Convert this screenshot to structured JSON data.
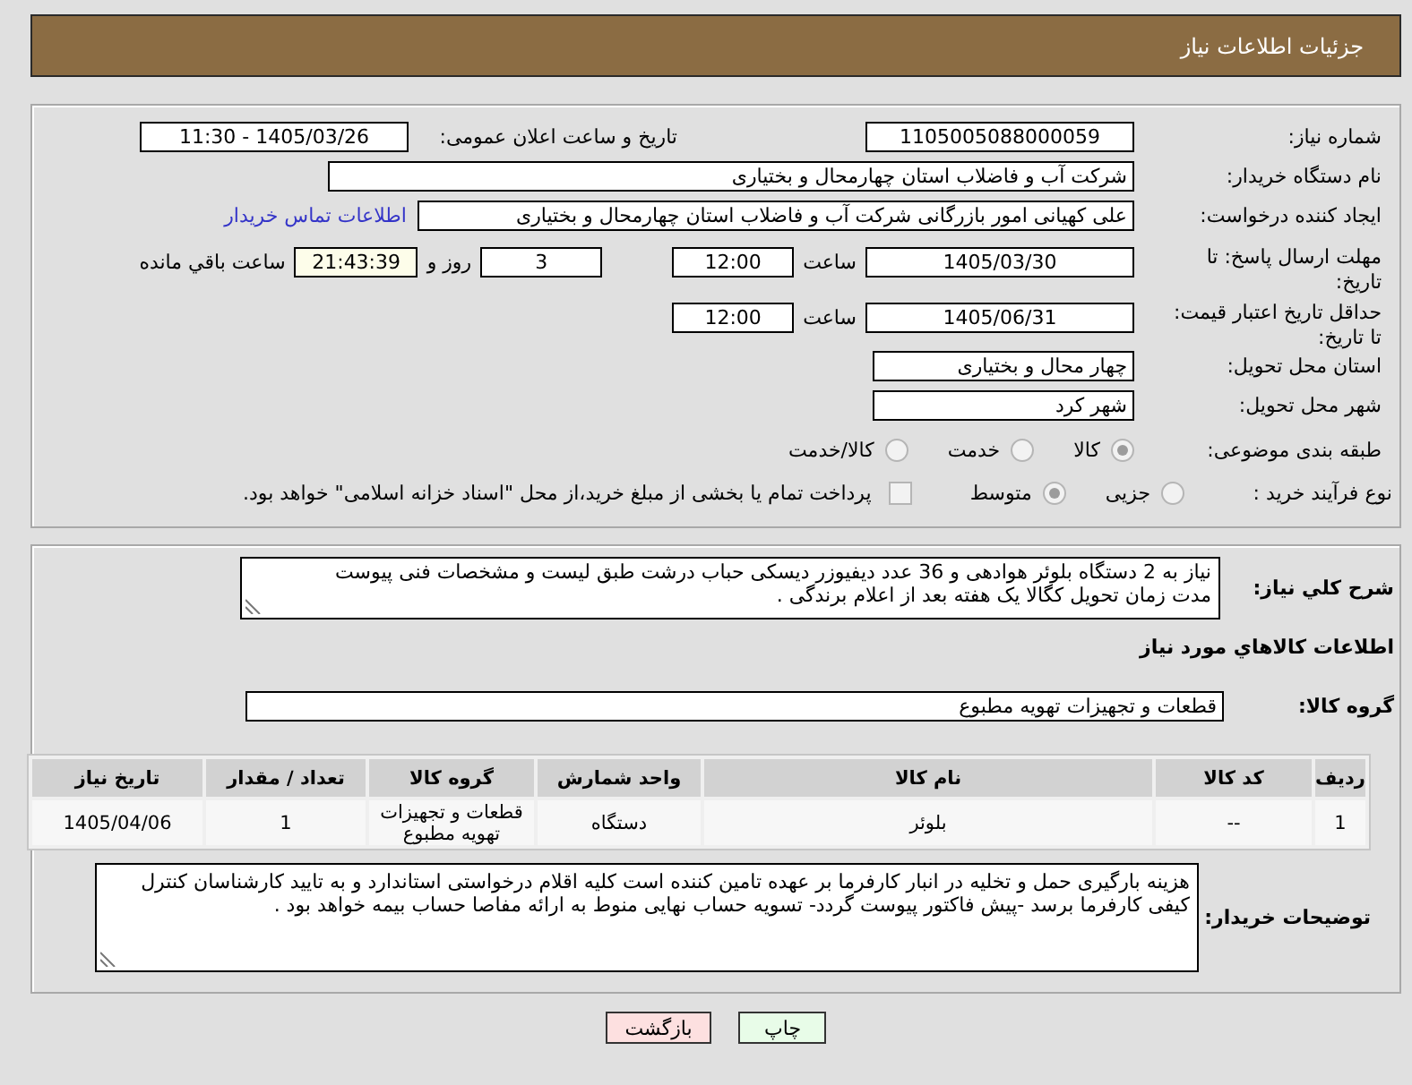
{
  "header": {
    "title": "جزئیات اطلاعات نیاز"
  },
  "details": {
    "need_number": {
      "label": "شماره نیاز:",
      "value": "1105005088000059"
    },
    "announce": {
      "label": "تاریخ و ساعت اعلان عمومی:",
      "value": "1405/03/26 - 11:30"
    },
    "buyer_org": {
      "label": "نام دستگاه خریدار:",
      "value": "شرکت آب و فاضلاب استان چهارمحال و بختیاری"
    },
    "requester": {
      "label": "ایجاد کننده درخواست:",
      "value": "علی کهیانی امور بازرگانی شرکت آب و فاضلاب استان چهارمحال و بختیاری",
      "link": "اطلاعات تماس خریدار"
    },
    "response_deadline": {
      "label": "مهلت ارسال پاسخ: تا تاریخ:",
      "date": "1405/03/30",
      "time_label": "ساعت",
      "time": "12:00",
      "days": "3",
      "days_label": "روز و",
      "remaining": "21:43:39",
      "remaining_label": "ساعت باقي مانده"
    },
    "price_validity": {
      "label": "حداقل تاریخ اعتبار قیمت: تا تاریخ:",
      "date": "1405/06/31",
      "time_label": "ساعت",
      "time": "12:00"
    },
    "delivery_province": {
      "label": "استان محل تحویل:",
      "value": "چهار محال و بختیاری"
    },
    "delivery_city": {
      "label": "شهر محل تحویل:",
      "value": "شهر کرد"
    },
    "subject_category": {
      "label": "طبقه بندی موضوعی:",
      "options": [
        {
          "label": "کالا",
          "selected": true
        },
        {
          "label": "خدمت",
          "selected": false
        },
        {
          "label": "کالا/خدمت",
          "selected": false
        }
      ]
    },
    "purchase_type": {
      "label": "نوع فرآیند خرید :",
      "options": [
        {
          "label": "جزیی",
          "selected": false
        },
        {
          "label": "متوسط",
          "selected": true
        }
      ],
      "treasury_payment": {
        "label": "پرداخت تمام یا بخشی از مبلغ خرید،از محل \"اسناد خزانه اسلامی\" خواهد بود.",
        "checked": false
      }
    }
  },
  "description": {
    "label": "شرح كلي نياز:",
    "value": "نیاز به 2 دستگاه بلوئر هوادهی و 36 عدد دیفیوزر دیسکی حباب درشت طبق لیست و مشخصات فنی پیوست\nمدت زمان تحویل کگالا یک هفته بعد از اعلام برندگی ."
  },
  "goods": {
    "title": "اطلاعات كالاهاي مورد نياز",
    "group_label": "گروه كالا:",
    "group_value": "قطعات و تجهیزات تهویه مطبوع",
    "table": {
      "columns": [
        "ردیف",
        "کد کالا",
        "نام کالا",
        "واحد شمارش",
        "گروه کالا",
        "تعداد / مقدار",
        "تاریخ نیاز"
      ],
      "rows": [
        [
          "1",
          "--",
          "بلوئر",
          "دستگاه",
          "قطعات و تجهیزات تهویه مطبوع",
          "1",
          "1405/04/06"
        ]
      ]
    }
  },
  "buyer_notes": {
    "label": "توضیحات خریدار:",
    "value": "هزینه بارگیری حمل و تخلیه در انبار کارفرما بر عهده تامین کننده است کلیه اقلام درخواستی استاندارد و به تایید کارشناسان کنترل کیفی کارفرما برسد -پیش فاکتور پیوست گردد- تسویه حساب نهایی منوط به ارائه مفاصا حساب بیمه خواهد بود ."
  },
  "buttons": [
    {
      "label": "چاپ",
      "kind": "print"
    },
    {
      "label": "بازگشت",
      "kind": "back"
    }
  ]
}
